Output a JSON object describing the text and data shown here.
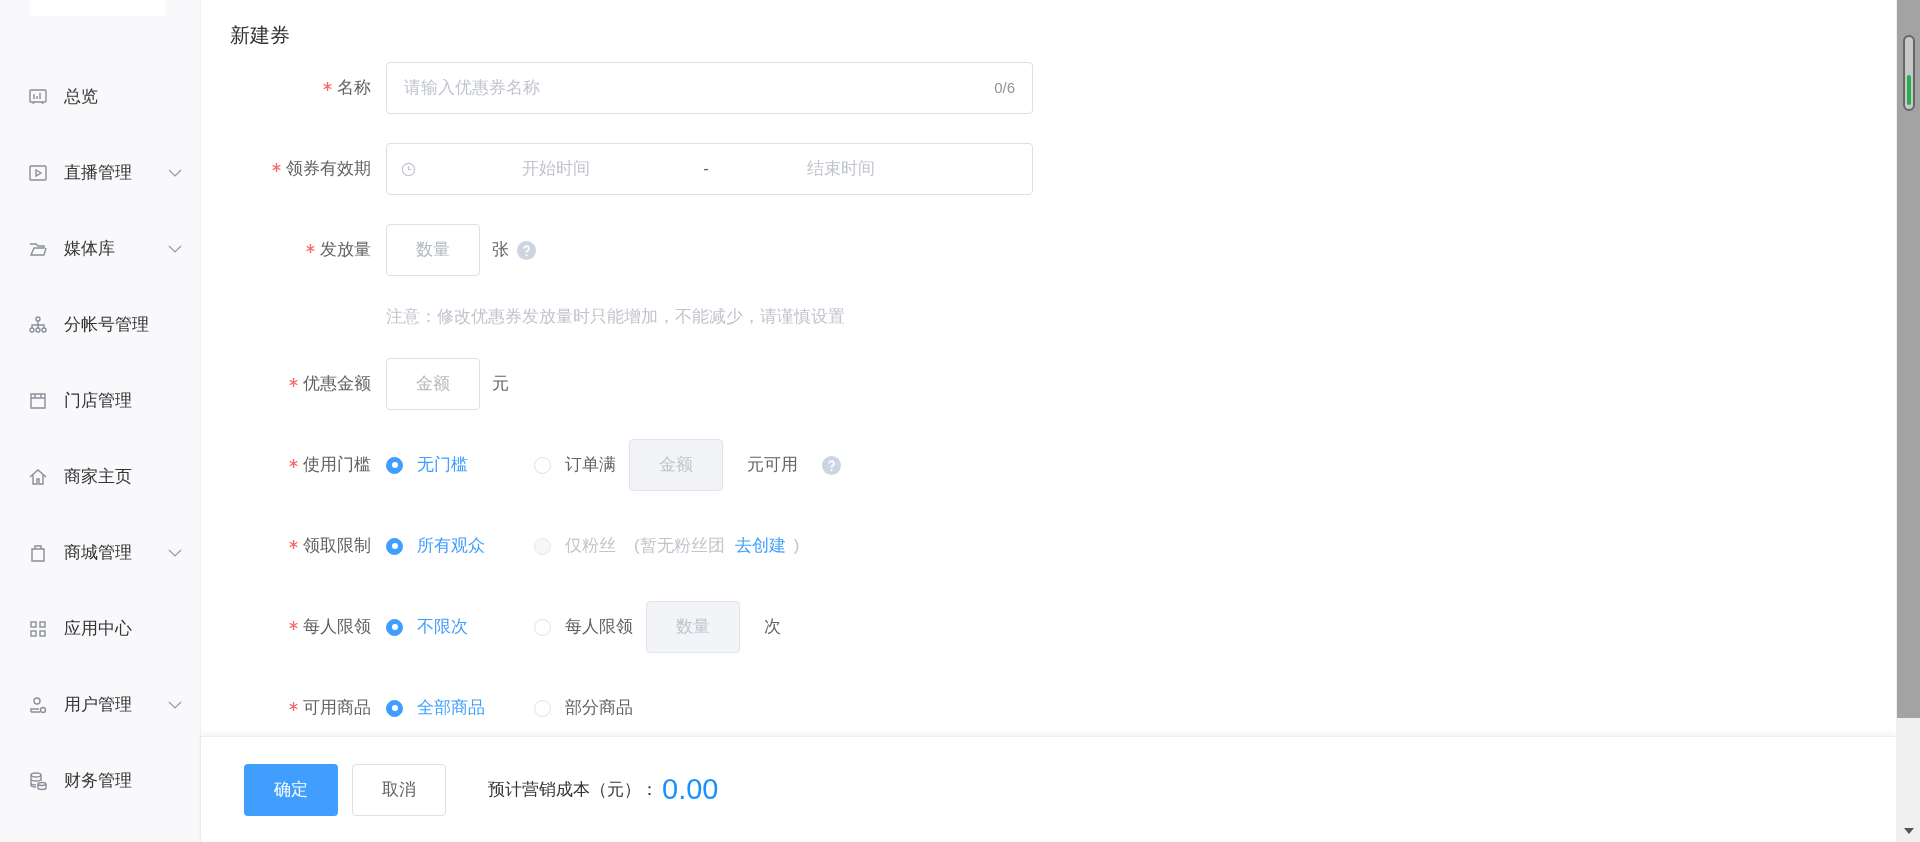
{
  "sidebar": {
    "items": [
      {
        "label": "总览",
        "has_submenu": false
      },
      {
        "label": "直播管理",
        "has_submenu": true
      },
      {
        "label": "媒体库",
        "has_submenu": true
      },
      {
        "label": "分帐号管理",
        "has_submenu": false
      },
      {
        "label": "门店管理",
        "has_submenu": false
      },
      {
        "label": "商家主页",
        "has_submenu": false
      },
      {
        "label": "商城管理",
        "has_submenu": true
      },
      {
        "label": "应用中心",
        "has_submenu": false
      },
      {
        "label": "用户管理",
        "has_submenu": true
      },
      {
        "label": "财务管理",
        "has_submenu": false
      }
    ]
  },
  "form": {
    "title": "新建券",
    "fields": [
      {
        "kind": "text",
        "label": "名称",
        "required": true,
        "placeholder": "请输入优惠券名称",
        "counter": "0/6"
      },
      {
        "kind": "range",
        "label": "领券有效期",
        "required": true,
        "start_placeholder": "开始时间",
        "separator": "-",
        "end_placeholder": "结束时间"
      },
      {
        "kind": "number",
        "label": "发放量",
        "required": true,
        "placeholder": "数量",
        "unit": "张",
        "help": true
      },
      {
        "kind": "note",
        "text": "注意：修改优惠券发放量时只能增加，不能减少，请谨慎设置"
      },
      {
        "kind": "number",
        "label": "优惠金额",
        "required": true,
        "placeholder": "金额",
        "unit": "元",
        "help": false
      },
      {
        "kind": "radio",
        "label": "使用门槛",
        "required": true,
        "options": [
          {
            "label": "无门槛",
            "selected": true,
            "disabled": false
          },
          {
            "label": "订单满",
            "selected": false,
            "disabled": false,
            "input": {
              "placeholder": "金额",
              "disabled": true
            },
            "suffix": "元可用",
            "help": true
          }
        ]
      },
      {
        "kind": "radio",
        "label": "领取限制",
        "required": true,
        "options": [
          {
            "label": "所有观众",
            "selected": true,
            "disabled": false
          },
          {
            "label": "仅粉丝",
            "selected": false,
            "disabled": true,
            "hint": "(暂无粉丝团",
            "link": "去创建",
            "hint_end": ")"
          }
        ]
      },
      {
        "kind": "radio",
        "label": "每人限领",
        "required": true,
        "options": [
          {
            "label": "不限次",
            "selected": true,
            "disabled": false
          },
          {
            "label": "每人限领",
            "selected": false,
            "disabled": false,
            "input": {
              "placeholder": "数量",
              "disabled": true
            },
            "suffix": "次"
          }
        ]
      },
      {
        "kind": "radio",
        "label": "可用商品",
        "required": true,
        "options": [
          {
            "label": "全部商品",
            "selected": true,
            "disabled": false
          },
          {
            "label": "部分商品",
            "selected": false,
            "disabled": false
          }
        ]
      }
    ]
  },
  "footer": {
    "buttons": [
      {
        "label": "确定",
        "kind": "primary"
      },
      {
        "label": "取消",
        "kind": "default"
      }
    ],
    "cost_label": "预计营销成本（元）：",
    "cost_value": "0.00"
  }
}
